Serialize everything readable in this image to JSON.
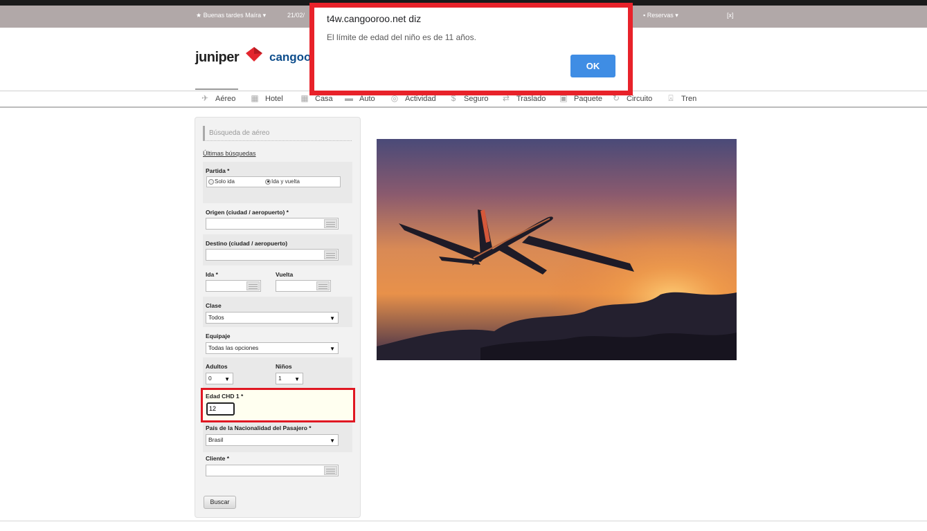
{
  "topbar": {
    "greeting": "Buenas tardes Maíra",
    "date": "21/02/",
    "reservas": "Reservas",
    "close": "[x]"
  },
  "logo": {
    "left": "juniper",
    "right": "cangoor"
  },
  "nav": {
    "items": [
      {
        "label": "Aéreo",
        "icon": "plane-icon"
      },
      {
        "label": "Hotel",
        "icon": "hotel-icon"
      },
      {
        "label": "Casa",
        "icon": "house-icon"
      },
      {
        "label": "Auto",
        "icon": "car-icon"
      },
      {
        "label": "Actividad",
        "icon": "activity-icon"
      },
      {
        "label": "Seguro",
        "icon": "dollar-icon"
      },
      {
        "label": "Traslado",
        "icon": "transfer-icon"
      },
      {
        "label": "Paquete",
        "icon": "package-icon"
      },
      {
        "label": "Circuito",
        "icon": "circuit-icon"
      },
      {
        "label": "Tren",
        "icon": "train-icon"
      }
    ]
  },
  "form": {
    "title": "Búsqueda de aéreo",
    "last_searches": "Últimas búsquedas",
    "partida_label": "Partida *",
    "solo_ida": "Solo ida",
    "ida_y_vuelta": "Ida y vuelta",
    "origen_label": "Origen (ciudad / aeropuerto) *",
    "origen_value": "",
    "destino_label": "Destino (ciudad / aeropuerto)",
    "destino_value": "",
    "ida_label": "Ida *",
    "vuelta_label": "Vuelta",
    "clase_label": "Clase",
    "clase_value": "Todos",
    "equipaje_label": "Equipaje",
    "equipaje_value": "Todas las opciones",
    "adultos_label": "Adultos",
    "adultos_value": "0",
    "ninos_label": "Niños",
    "ninos_value": "1",
    "edad_label": "Edad CHD 1 *",
    "edad_value": "12",
    "pais_label": "País de la Nacionalidad del Pasajero *",
    "pais_value": "Brasil",
    "cliente_label": "Cliente *",
    "buscar": "Buscar"
  },
  "dialog": {
    "title": "t4w.cangooroo.net diz",
    "message": "El límite de edad del niño es de 11 años.",
    "ok": "OK"
  }
}
